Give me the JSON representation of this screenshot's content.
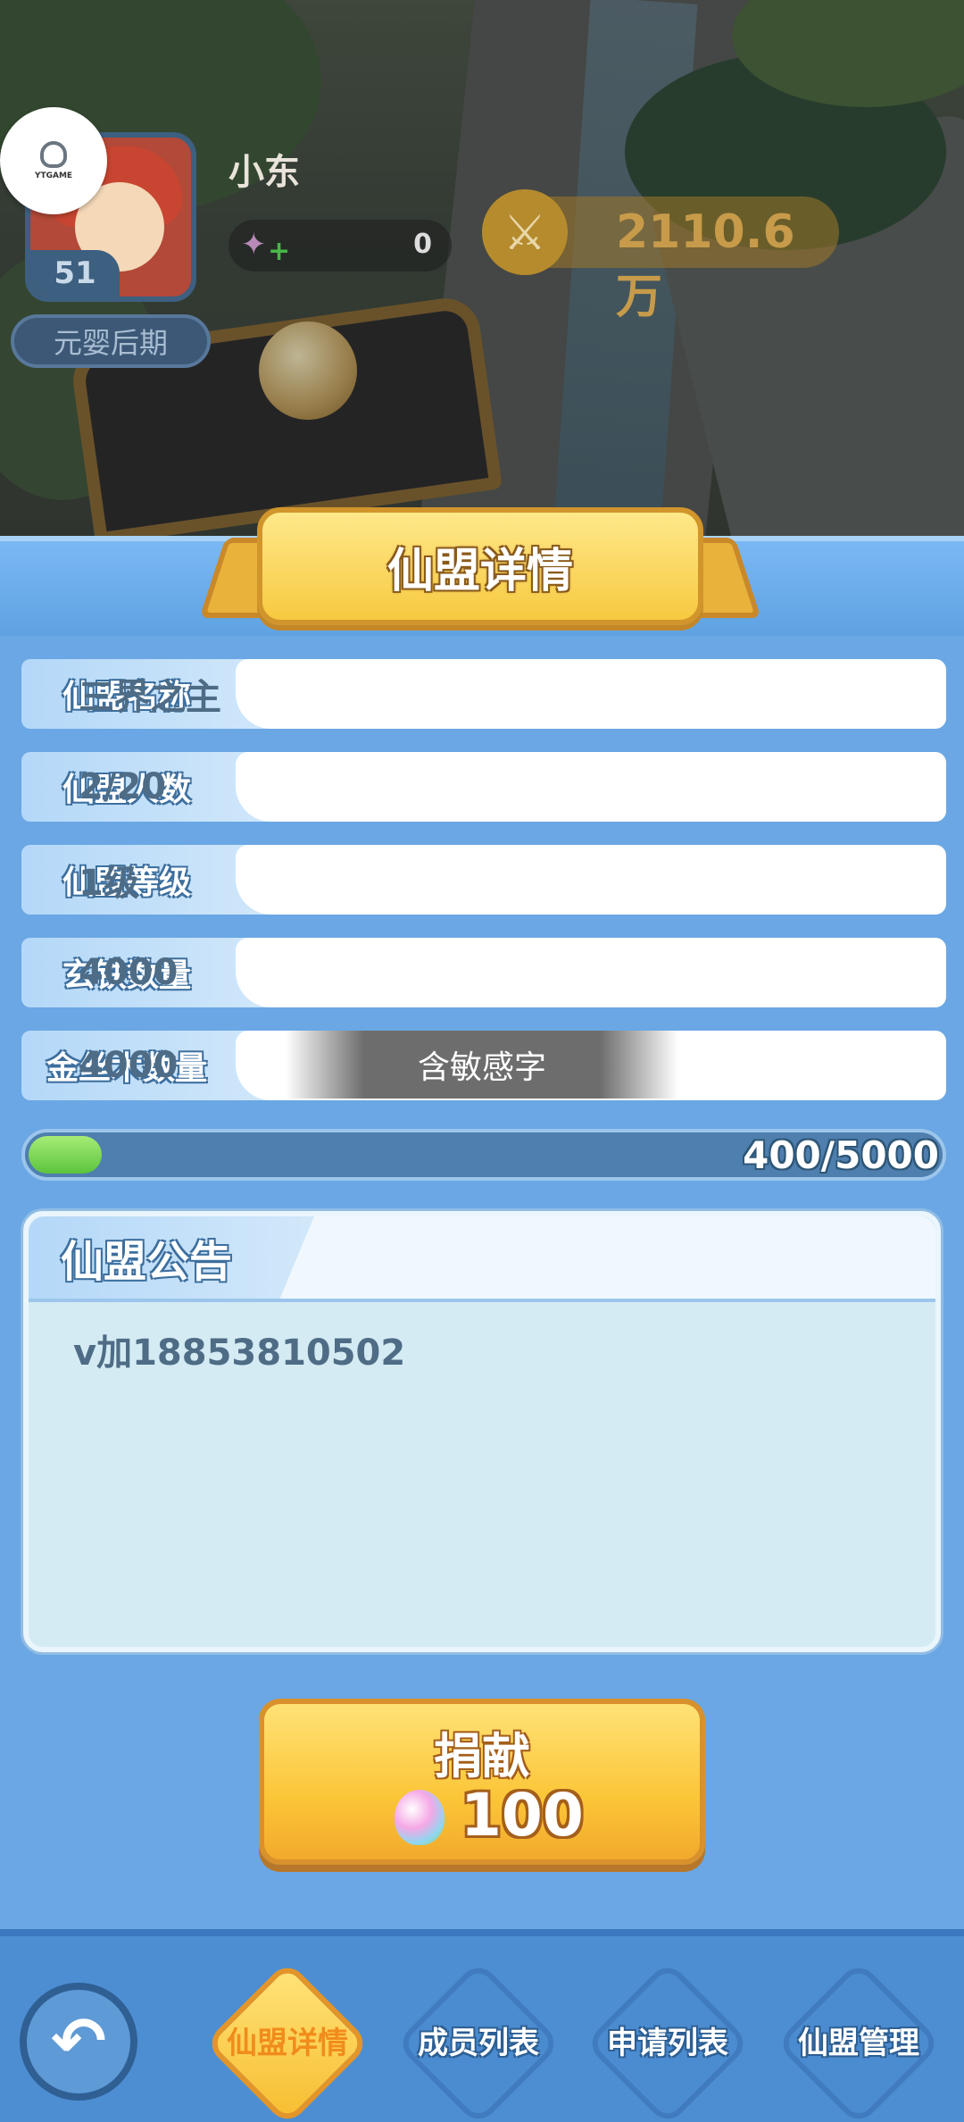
{
  "player": {
    "name": "小东",
    "level": "51",
    "realm": "元婴后期",
    "xp_value": "0",
    "combat_power": "2110.6万",
    "sponsor_logo_text": "YTGAME"
  },
  "panel": {
    "title": "仙盟详情",
    "rows": [
      {
        "label": "仙盟名称",
        "value": "三界之主"
      },
      {
        "label": "仙盟人数",
        "value": "2/20"
      },
      {
        "label": "仙盟等级",
        "value": "1级"
      },
      {
        "label": "玄铁数量",
        "value": "4000"
      },
      {
        "label": "金丝木数量",
        "value": "4000"
      }
    ],
    "toast": "含敏感字",
    "progress": {
      "text": "400/5000",
      "current": 400,
      "max": 5000
    },
    "notice": {
      "label": "仙盟公告",
      "body": "v加18853810502"
    },
    "donate": {
      "label": "捐献",
      "cost": "100",
      "cost_icon": "gem-icon"
    }
  },
  "nav": {
    "back_icon": "back-arrow-icon",
    "tabs": [
      {
        "label": "仙盟详情",
        "active": true
      },
      {
        "label": "成员列表",
        "active": false
      },
      {
        "label": "申请列表",
        "active": false
      },
      {
        "label": "仙盟管理",
        "active": false
      }
    ]
  },
  "colors": {
    "panel_blue": "#6aa7e4",
    "accent_gold": "#f7c940",
    "progress_green": "#5cc43c",
    "value_text": "#4e6c85"
  }
}
